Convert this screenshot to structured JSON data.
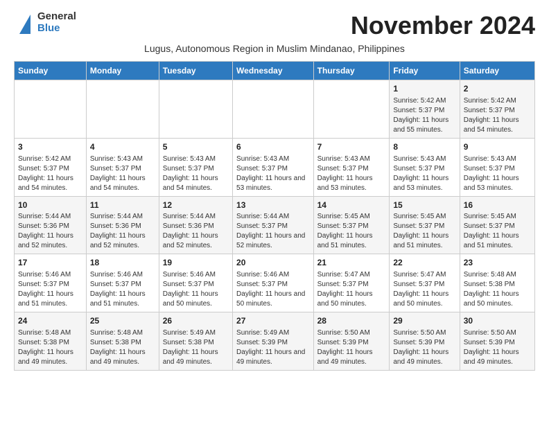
{
  "logo": {
    "general": "General",
    "blue": "Blue"
  },
  "title": "November 2024",
  "subtitle": "Lugus, Autonomous Region in Muslim Mindanao, Philippines",
  "headers": [
    "Sunday",
    "Monday",
    "Tuesday",
    "Wednesday",
    "Thursday",
    "Friday",
    "Saturday"
  ],
  "weeks": [
    [
      {
        "day": "",
        "info": ""
      },
      {
        "day": "",
        "info": ""
      },
      {
        "day": "",
        "info": ""
      },
      {
        "day": "",
        "info": ""
      },
      {
        "day": "",
        "info": ""
      },
      {
        "day": "1",
        "info": "Sunrise: 5:42 AM\nSunset: 5:37 PM\nDaylight: 11 hours and 55 minutes."
      },
      {
        "day": "2",
        "info": "Sunrise: 5:42 AM\nSunset: 5:37 PM\nDaylight: 11 hours and 54 minutes."
      }
    ],
    [
      {
        "day": "3",
        "info": "Sunrise: 5:42 AM\nSunset: 5:37 PM\nDaylight: 11 hours and 54 minutes."
      },
      {
        "day": "4",
        "info": "Sunrise: 5:43 AM\nSunset: 5:37 PM\nDaylight: 11 hours and 54 minutes."
      },
      {
        "day": "5",
        "info": "Sunrise: 5:43 AM\nSunset: 5:37 PM\nDaylight: 11 hours and 54 minutes."
      },
      {
        "day": "6",
        "info": "Sunrise: 5:43 AM\nSunset: 5:37 PM\nDaylight: 11 hours and 53 minutes."
      },
      {
        "day": "7",
        "info": "Sunrise: 5:43 AM\nSunset: 5:37 PM\nDaylight: 11 hours and 53 minutes."
      },
      {
        "day": "8",
        "info": "Sunrise: 5:43 AM\nSunset: 5:37 PM\nDaylight: 11 hours and 53 minutes."
      },
      {
        "day": "9",
        "info": "Sunrise: 5:43 AM\nSunset: 5:37 PM\nDaylight: 11 hours and 53 minutes."
      }
    ],
    [
      {
        "day": "10",
        "info": "Sunrise: 5:44 AM\nSunset: 5:36 PM\nDaylight: 11 hours and 52 minutes."
      },
      {
        "day": "11",
        "info": "Sunrise: 5:44 AM\nSunset: 5:36 PM\nDaylight: 11 hours and 52 minutes."
      },
      {
        "day": "12",
        "info": "Sunrise: 5:44 AM\nSunset: 5:36 PM\nDaylight: 11 hours and 52 minutes."
      },
      {
        "day": "13",
        "info": "Sunrise: 5:44 AM\nSunset: 5:37 PM\nDaylight: 11 hours and 52 minutes."
      },
      {
        "day": "14",
        "info": "Sunrise: 5:45 AM\nSunset: 5:37 PM\nDaylight: 11 hours and 51 minutes."
      },
      {
        "day": "15",
        "info": "Sunrise: 5:45 AM\nSunset: 5:37 PM\nDaylight: 11 hours and 51 minutes."
      },
      {
        "day": "16",
        "info": "Sunrise: 5:45 AM\nSunset: 5:37 PM\nDaylight: 11 hours and 51 minutes."
      }
    ],
    [
      {
        "day": "17",
        "info": "Sunrise: 5:46 AM\nSunset: 5:37 PM\nDaylight: 11 hours and 51 minutes."
      },
      {
        "day": "18",
        "info": "Sunrise: 5:46 AM\nSunset: 5:37 PM\nDaylight: 11 hours and 51 minutes."
      },
      {
        "day": "19",
        "info": "Sunrise: 5:46 AM\nSunset: 5:37 PM\nDaylight: 11 hours and 50 minutes."
      },
      {
        "day": "20",
        "info": "Sunrise: 5:46 AM\nSunset: 5:37 PM\nDaylight: 11 hours and 50 minutes."
      },
      {
        "day": "21",
        "info": "Sunrise: 5:47 AM\nSunset: 5:37 PM\nDaylight: 11 hours and 50 minutes."
      },
      {
        "day": "22",
        "info": "Sunrise: 5:47 AM\nSunset: 5:37 PM\nDaylight: 11 hours and 50 minutes."
      },
      {
        "day": "23",
        "info": "Sunrise: 5:48 AM\nSunset: 5:38 PM\nDaylight: 11 hours and 50 minutes."
      }
    ],
    [
      {
        "day": "24",
        "info": "Sunrise: 5:48 AM\nSunset: 5:38 PM\nDaylight: 11 hours and 49 minutes."
      },
      {
        "day": "25",
        "info": "Sunrise: 5:48 AM\nSunset: 5:38 PM\nDaylight: 11 hours and 49 minutes."
      },
      {
        "day": "26",
        "info": "Sunrise: 5:49 AM\nSunset: 5:38 PM\nDaylight: 11 hours and 49 minutes."
      },
      {
        "day": "27",
        "info": "Sunrise: 5:49 AM\nSunset: 5:39 PM\nDaylight: 11 hours and 49 minutes."
      },
      {
        "day": "28",
        "info": "Sunrise: 5:50 AM\nSunset: 5:39 PM\nDaylight: 11 hours and 49 minutes."
      },
      {
        "day": "29",
        "info": "Sunrise: 5:50 AM\nSunset: 5:39 PM\nDaylight: 11 hours and 49 minutes."
      },
      {
        "day": "30",
        "info": "Sunrise: 5:50 AM\nSunset: 5:39 PM\nDaylight: 11 hours and 49 minutes."
      }
    ]
  ]
}
